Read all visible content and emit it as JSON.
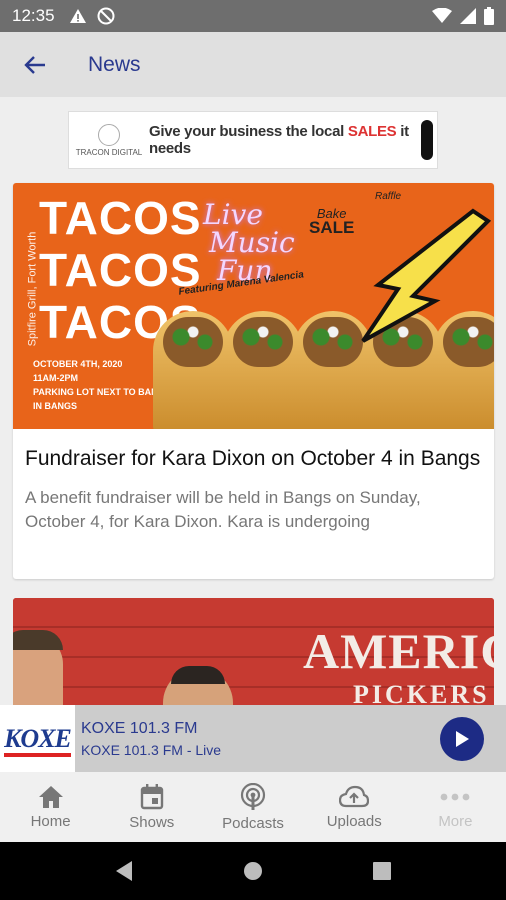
{
  "status_bar": {
    "time": "12:35",
    "left_icons": [
      "warning-icon",
      "no-sync-icon"
    ],
    "right_icons": [
      "wifi-icon",
      "signal-icon",
      "battery-icon"
    ]
  },
  "app_bar": {
    "back_icon": "arrow-back-icon",
    "title": "News"
  },
  "ad": {
    "brand": "TRACON DIGITAL",
    "text_part1": "Give your business the local ",
    "text_highlight": "SALES",
    "text_part2": " it needs"
  },
  "article_1": {
    "image": {
      "taco_word": "TACOS",
      "side_text": "Spitfire Grill, Fort Worth",
      "date": "OCTOBER 4TH, 2020",
      "time": "11AM-2PM",
      "location_line1": "PARKING LOT NEXT TO BANGS BEER BARN",
      "location_line2": "IN BANGS",
      "live_music_1": "Live",
      "live_music_2": "Music",
      "live_music_3": "Fun",
      "featuring": "Featuring Marena Valencia",
      "bake": "Bake",
      "sale": "SALE",
      "raffle": "Raffle"
    },
    "title": "Fundraiser for Kara Dixon on October 4 in Bangs",
    "summary": "A benefit fundraiser will be held in Bangs on Sunday, October 4, for Kara Dixon.  Kara is undergoing"
  },
  "article_2": {
    "image": {
      "line1": "AMERICAN",
      "line2": "PICKERS"
    }
  },
  "player": {
    "logo_text": "KOXE",
    "station": "KOXE 101.3 FM",
    "subtitle": "KOXE 101.3 FM  - Live",
    "play_icon": "play-icon"
  },
  "bottom_nav": {
    "items": [
      {
        "label": "Home",
        "icon": "home-icon"
      },
      {
        "label": "Shows",
        "icon": "calendar-icon"
      },
      {
        "label": "Podcasts",
        "icon": "podcast-icon"
      },
      {
        "label": "Uploads",
        "icon": "cloud-upload-icon"
      },
      {
        "label": "More",
        "icon": "more-icon"
      }
    ]
  },
  "system_nav": [
    "back-icon",
    "home-circle-icon",
    "recents-icon"
  ]
}
